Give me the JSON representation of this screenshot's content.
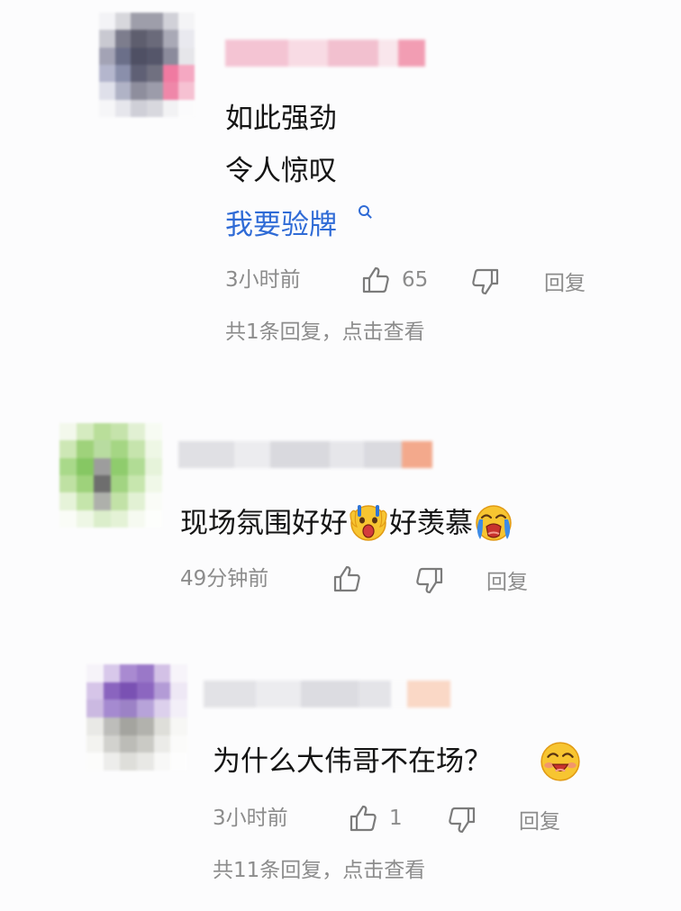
{
  "comments": [
    {
      "body_lines": [
        "如此强劲",
        "令人惊叹"
      ],
      "link_text": "我要验牌",
      "time": "3小时前",
      "like_count": "65",
      "reply_label": "回复",
      "replies_summary": "共1条回复，点击查看"
    },
    {
      "body_parts": [
        "现场氛围好好",
        "好羡慕"
      ],
      "time": "49分钟前",
      "reply_label": "回复"
    },
    {
      "body_text": "为什么大伟哥不在场？",
      "time": "3小时前",
      "like_count": "1",
      "reply_label": "回复",
      "replies_summary": "共11条回复，点击查看"
    }
  ],
  "icons": {
    "like": "thumbs-up-outline-icon",
    "dislike": "thumbs-down-outline-icon",
    "emojis": [
      "surprised-face-emoji",
      "crying-face-emoji",
      "blushing-laughing-face-emoji"
    ]
  },
  "colors": {
    "link": "#2f6bd6",
    "meta": "#8c8c8c",
    "body_text": "#141414"
  }
}
